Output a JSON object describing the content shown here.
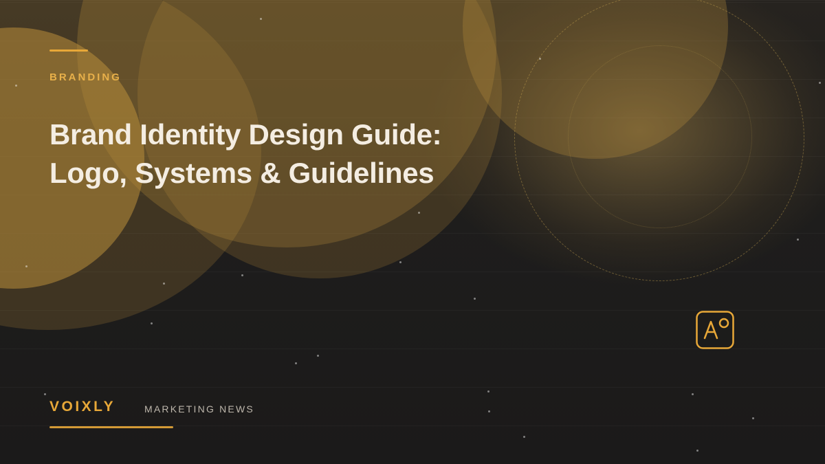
{
  "category": "BRANDING",
  "title_lines": [
    "Brand Identity Design Guide:",
    "Logo, Systems & Guidelines"
  ],
  "footer": {
    "brand": "VOIXLY",
    "section": "MARKETING NEWS"
  },
  "colors": {
    "accent": "#e8a838",
    "title_text": "#f4ede2",
    "background": "#1b1a1a",
    "circle_gold": "#ba8e3a"
  },
  "icons": [
    "typography-icon"
  ]
}
